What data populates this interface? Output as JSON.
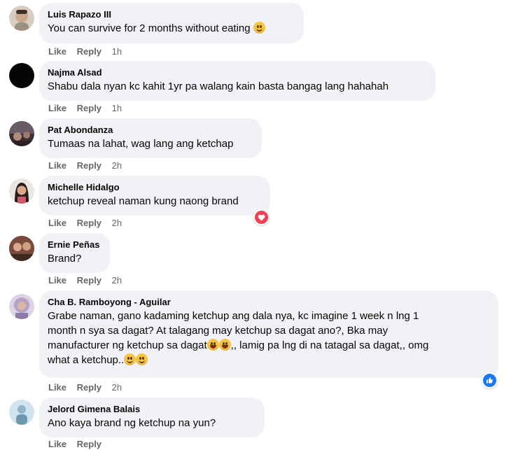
{
  "actions": {
    "like": "Like",
    "reply": "Reply"
  },
  "comments": [
    {
      "name": "Luis Rapazo III",
      "text": "You can survive for 2 months without eating",
      "emoji_after": "slight-smile",
      "time": "1h"
    },
    {
      "name": "Najma Alsad",
      "text": "Shabu dala nyan kc kahit 1yr pa walang kain basta bangag lang hahahah",
      "time": "1h"
    },
    {
      "name": "Pat Abondanza",
      "text": "Tumaas na lahat, wag lang ang ketchap",
      "time": "2h"
    },
    {
      "name": "Michelle Hidalgo",
      "text": "ketchup reveal naman kung naong brand",
      "time": "2h",
      "reaction": "heart-icon"
    },
    {
      "name": "Ernie Peñas",
      "text": "Brand?",
      "time": "2h"
    },
    {
      "name": "Cha B. Ramboyong - Aguilar",
      "lines": [
        "Grabe naman, gano kadaming ketchup ang dala nya, kc imagine 1 week n lng 1",
        "month n sya sa dagat? At talagang may ketchup sa dagat ano?, Bka may",
        "manufacturer ng ketchup sa dagat",
        ",, lamig pa lng di na tatagal sa dagat,, omg",
        "what a ketchup.."
      ],
      "time": "2h",
      "reaction": "like-icon"
    },
    {
      "name": "Jelord Gimena Balais",
      "text": "Ano kaya brand ng ketchup na yun?",
      "time": ""
    }
  ],
  "colors": {
    "bubble": "#f0f2f5",
    "meta": "#65676b",
    "like_blue": "#1877f2",
    "love_red": "#f33e58"
  }
}
